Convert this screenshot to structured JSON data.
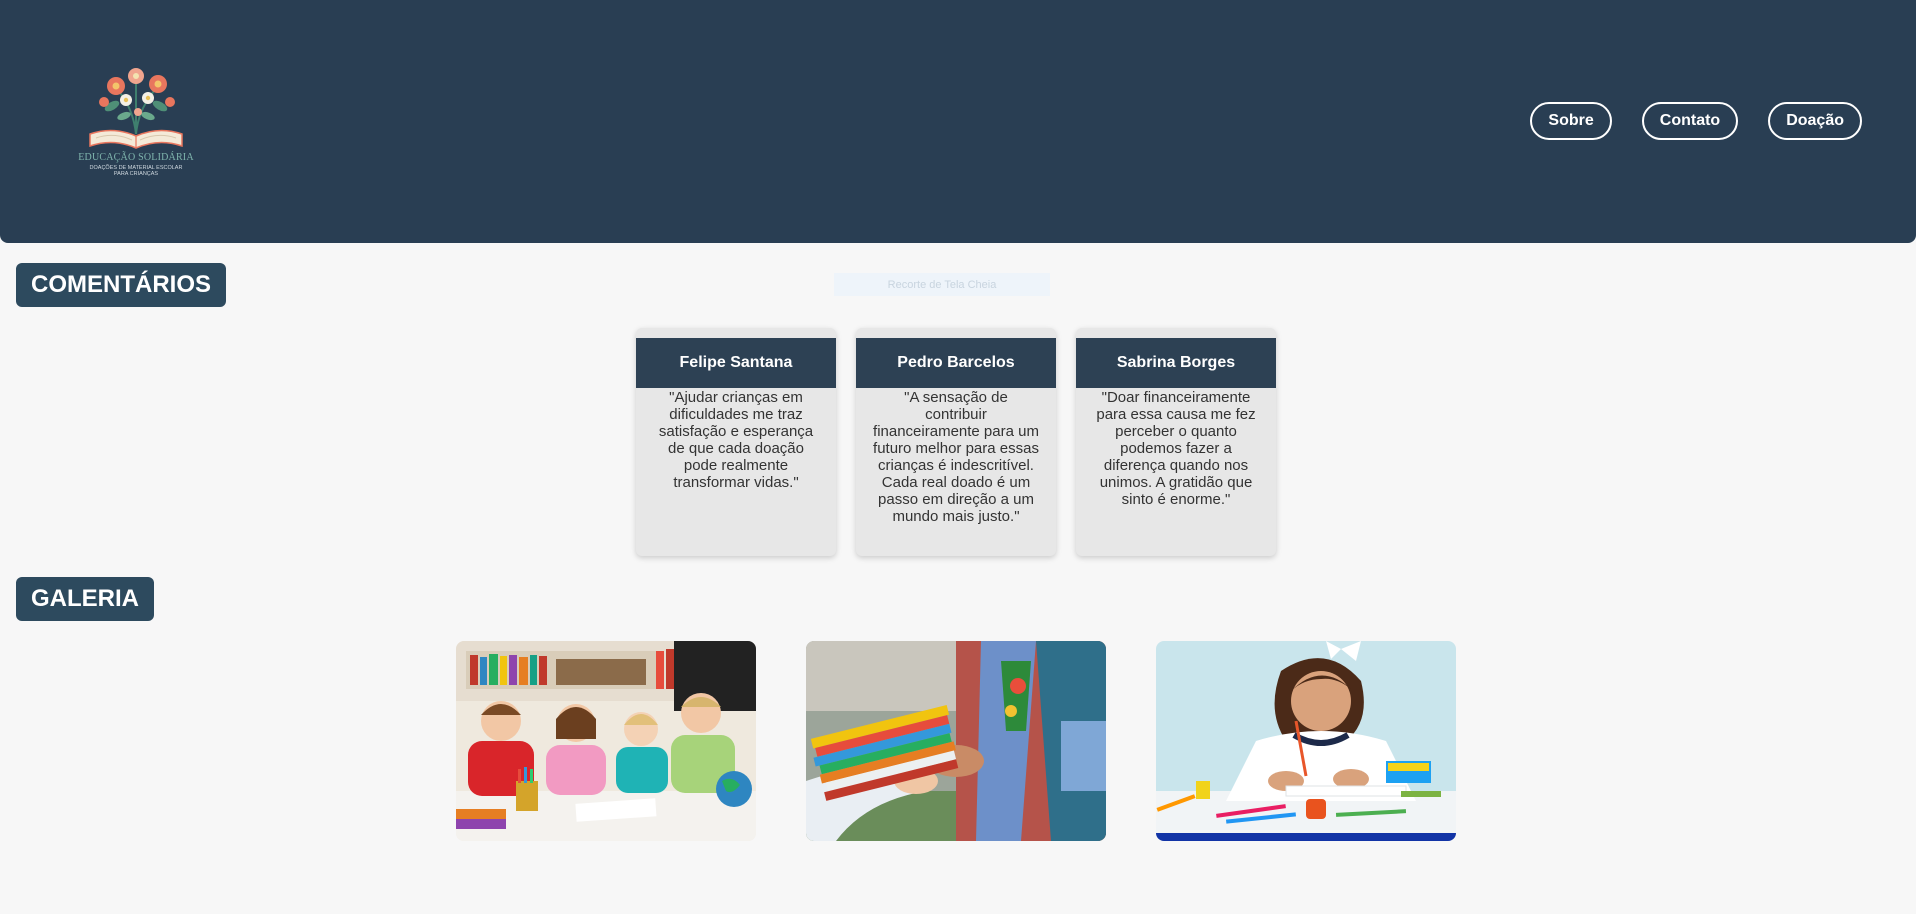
{
  "header": {
    "logo": {
      "title": "EDUCAÇÃO SOLIDÁRIA",
      "subtitle_line1": "DOAÇÕES DE MATERIAL ESCOLAR",
      "subtitle_line2": "PARA CRIANÇAS"
    },
    "nav": [
      {
        "label": "Sobre"
      },
      {
        "label": "Contato"
      },
      {
        "label": "Doação"
      }
    ]
  },
  "tooltip": "Recorte de Tela Cheia",
  "comments": {
    "title": "COMENTÁRIOS",
    "items": [
      {
        "name": "Felipe Santana",
        "text": "\"Ajudar crianças em dificuldades me traz satisfação e esperança de que cada doação pode realmente transformar vidas.\""
      },
      {
        "name": "Pedro Barcelos",
        "text": "\"A sensação de contribuir financeiramente para um futuro melhor para essas crianças é indescritível. Cada real doado é um passo em direção a um mundo mais justo.\""
      },
      {
        "name": "Sabrina Borges",
        "text": "\"Doar financeiramente para essa causa me fez perceber o quanto podemos fazer a diferença quando nos unimos. A gratidão que sinto é enorme.\""
      }
    ]
  },
  "gallery": {
    "title": "GALERIA",
    "photos": [
      {
        "subject": "children-studying-photo"
      },
      {
        "subject": "school-supplies-donation-photo"
      },
      {
        "subject": "girl-drawing-photo"
      }
    ]
  },
  "colors": {
    "header_bg": "#293e53",
    "section_title_bg": "#2d4a5e",
    "card_head_bg": "#2d4154",
    "card_bg": "#e7e7e7",
    "page_bg": "#f7f7f7"
  }
}
